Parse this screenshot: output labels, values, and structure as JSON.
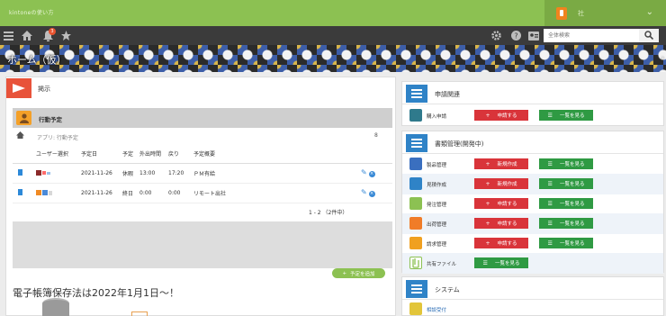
{
  "header": {
    "logo_text": "kintoneの使い方",
    "user_name": "社",
    "user_chevron": "⌄"
  },
  "toolbar": {
    "notification_count": "3",
    "search_placeholder": "全体検索"
  },
  "banner": {
    "title": "ホーム（仮）"
  },
  "board": {
    "title": "掲示",
    "schedule": {
      "title": "行動予定",
      "breadcrumb": "アプリ: 行動予定",
      "settings_mark": "8",
      "columns": [
        "ユーザー選択",
        "予定日",
        "予定",
        "外出時間",
        "戻り",
        "予定概要"
      ],
      "rows": [
        {
          "date": "2021-11-26",
          "type": "休暇",
          "out": "13:00",
          "back": "17:20",
          "summary": "ＰＭ有給"
        },
        {
          "date": "2021-11-26",
          "type": "終日",
          "out": "0:00",
          "back": "0:00",
          "summary": "リモート出社"
        }
      ],
      "pager": "1 - 2 （2件中）",
      "add_button": "予定を追加"
    },
    "notice": "電子帳簿保存法は2022年1月1日～！"
  },
  "right": {
    "applications": {
      "title": "申請関連",
      "rows": [
        {
          "label": "購入申請",
          "btn1": "申請する",
          "btn2": "一覧を見る"
        }
      ]
    },
    "documents": {
      "title": "書類管理(開発中)",
      "rows": [
        {
          "label": "製品管理",
          "btn1": "新規作成",
          "btn2": "一覧を見る"
        },
        {
          "label": "見積作成",
          "btn1": "新規作成",
          "btn2": "一覧を見る"
        },
        {
          "label": "発注管理",
          "btn1": "申請する",
          "btn2": "一覧を見る"
        },
        {
          "label": "出荷管理",
          "btn1": "申請する",
          "btn2": "一覧を見る"
        },
        {
          "label": "請求管理",
          "btn1": "申請する",
          "btn2": "一覧を見る"
        },
        {
          "label": "共有ファイル",
          "btn2": "一覧を見る"
        }
      ]
    },
    "system": {
      "title": "システム",
      "rows": [
        {
          "label": "相談受付"
        }
      ]
    }
  },
  "colors": {
    "header_green": "#8cc152",
    "toolbar_dark": "#3b3b3b",
    "accent_blue": "#2f83c7",
    "button_red": "#d9343a",
    "button_green": "#2f9a43"
  }
}
